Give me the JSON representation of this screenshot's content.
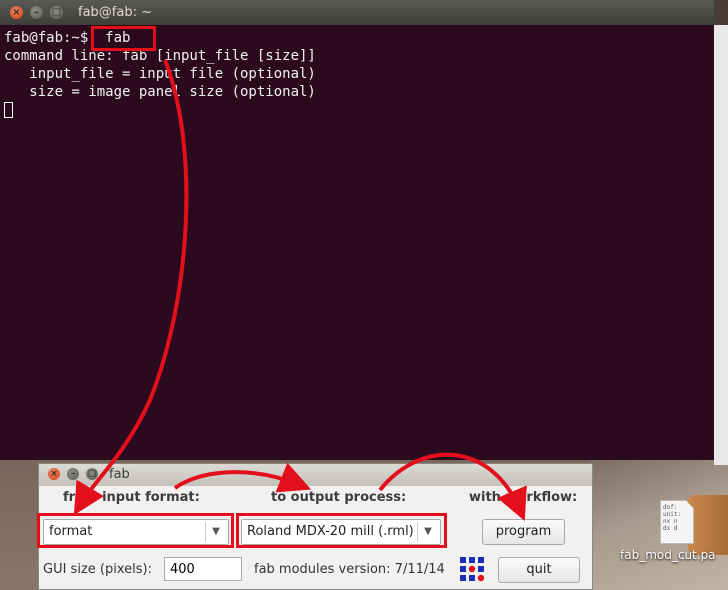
{
  "terminal": {
    "title": "fab@fab: ~",
    "prompt": "fab@fab:~$",
    "command": "fab",
    "lines": [
      "command line: fab [input_file [size]]",
      "   input_file = input file (optional)",
      "   size = image panel size (optional)"
    ]
  },
  "fab": {
    "title": "fab",
    "col_input": "from input format:",
    "col_output": "to output process:",
    "col_workflow": "with workflow:",
    "format_value": "format",
    "process_value": "Roland MDX-20 mill (.rml)",
    "program_label": "program",
    "gui_size_label": "GUI size (pixels):",
    "gui_size_value": "400",
    "version_label": "fab modules version: 7/11/14",
    "quit_label": "quit"
  },
  "desktop": {
    "file_label": "fab_mod_cut.pa",
    "file_preview": [
      "dof:",
      "unit:",
      "nx n",
      "dx d"
    ]
  },
  "colors": {
    "terminal_bg": "#2c0a1e",
    "highlight": "#e3101c",
    "close_button": "#d24418"
  },
  "icons": [
    "close-icon",
    "minimize-icon",
    "maximize-icon",
    "dropdown-arrow-icon",
    "fab-logo-icon",
    "document-icon"
  ]
}
